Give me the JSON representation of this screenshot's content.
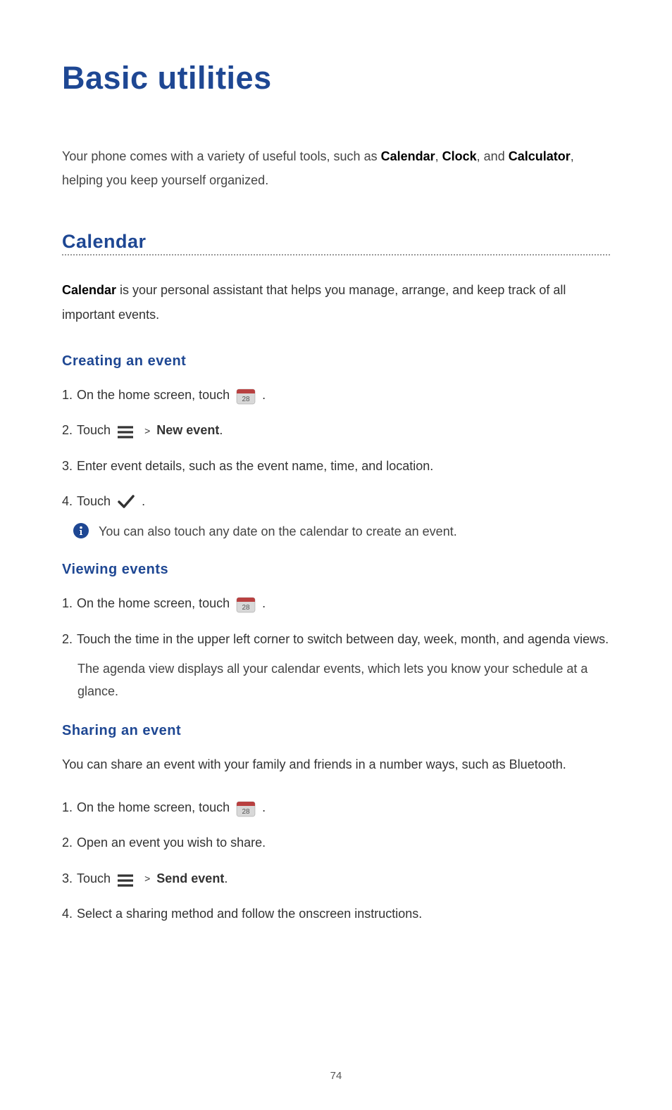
{
  "title": "Basic utilities",
  "intro": {
    "prefix": "Your phone comes with a variety of useful tools, such as ",
    "b1": "Calendar",
    "sep1": ", ",
    "b2": "Clock",
    "sep2": ", and ",
    "b3": "Calculator",
    "suffix": ", helping you keep yourself organized."
  },
  "calendar": {
    "heading": "Calendar",
    "desc_bold": "Calendar",
    "desc_rest": " is your personal assistant that helps you manage, arrange, and keep track of all important events."
  },
  "creating": {
    "heading": "Creating an event",
    "step1_num": "1. ",
    "step1_text": "On the home screen, touch  ",
    "step1_end": " .",
    "step2_num": "2. ",
    "step2_text": "Touch ",
    "step2_gt": ">",
    "step2_bold": "New event",
    "step2_end": ".",
    "step3_num": "3. ",
    "step3_text": "Enter event details, such as the event name, time, and location.",
    "step4_num": "4. ",
    "step4_text": "Touch ",
    "step4_end": " .",
    "note": "You can also touch any date on the calendar to create an event."
  },
  "viewing": {
    "heading": "Viewing events",
    "step1_num": "1. ",
    "step1_text": "On the home screen, touch  ",
    "step1_end": " .",
    "step2_num": "2. ",
    "step2_text": "Touch the time in the upper left corner to switch between day, week, month, and agenda views.",
    "detail": "The agenda view displays all your calendar events, which lets you know your schedule at a glance."
  },
  "sharing": {
    "heading": "Sharing an event",
    "intro": "You can share an event with your family and friends in a number ways, such as Bluetooth.",
    "step1_num": "1. ",
    "step1_text": "On the home screen, touch  ",
    "step1_end": " .",
    "step2_num": "2. ",
    "step2_text": "Open an event you wish to share.",
    "step3_num": "3. ",
    "step3_text": "Touch ",
    "step3_gt": ">",
    "step3_bold": "Send event",
    "step3_end": ".",
    "step4_num": "4. ",
    "step4_text": "Select a sharing method and follow the onscreen instructions."
  },
  "page_number": "74"
}
